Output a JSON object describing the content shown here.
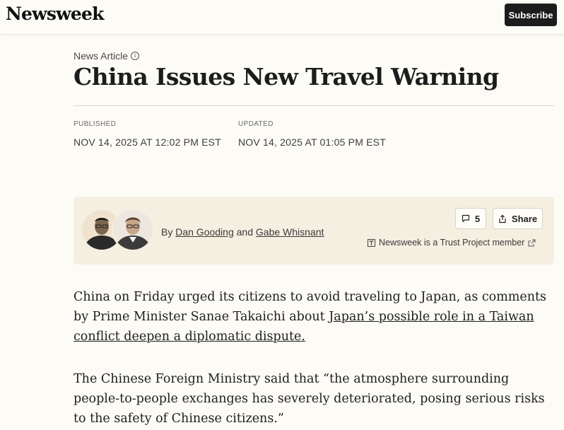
{
  "site": {
    "logo": "Newsweek",
    "subscribe_label": "Subscribe"
  },
  "article": {
    "kicker": "News Article",
    "headline": "China Issues New Travel Warning",
    "published_label": "PUBLISHED",
    "published_value": "NOV 14, 2025 AT 12:02 PM EST",
    "updated_label": "UPDATED",
    "updated_value": "NOV 14, 2025 AT 01:05 PM EST"
  },
  "byline": {
    "prefix": "By",
    "author1": "Dan Gooding",
    "conjunction": "and",
    "author2": "Gabe Whisnant",
    "comments_count": "5",
    "share_label": "Share",
    "trust_text": "Newsweek is a Trust Project member"
  },
  "body": {
    "p1_text": "China on Friday urged its citizens to avoid traveling to Japan, as comments by Prime Minister Sanae Takaichi about ",
    "p1_link": "Japan’s possible role in a Taiwan conflict deepen a diplomatic dispute.",
    "p2_text": "The Chinese Foreign Ministry said that “the atmosphere surrounding people-to-people exchanges has severely deteriorated, posing serious risks to the safety of Chinese citizens.”"
  },
  "icons": [
    "info-icon",
    "comment-icon",
    "share-icon",
    "trust-project-icon",
    "external-link-icon"
  ],
  "colors": {
    "background": "#fdfbf6",
    "byline_box": "#f5efe1",
    "button_dark": "#1c1c1c"
  }
}
